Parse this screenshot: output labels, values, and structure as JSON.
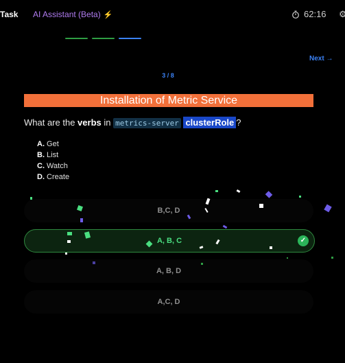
{
  "topbar": {
    "task_label": "Task",
    "ai_label": "AI Assistant (Beta)",
    "timer": "62:16"
  },
  "progress": {
    "segments": [
      {
        "color": "#2f9e44"
      },
      {
        "color": "#2f9e44"
      },
      {
        "color": "#3b82f6"
      }
    ]
  },
  "nav": {
    "next_label": "Next",
    "counter": "3 / 8"
  },
  "question": {
    "title": "Installation of Metric Service",
    "prefix": "What are the ",
    "bold": "verbs",
    "middle": " in ",
    "code": "metrics-server",
    "highlight": "clusterRole",
    "suffix": "?"
  },
  "options": [
    {
      "letter": "A.",
      "text": " Get"
    },
    {
      "letter": "B.",
      "text": " List"
    },
    {
      "letter": "C.",
      "text": " Watch"
    },
    {
      "letter": "D.",
      "text": " Create"
    }
  ],
  "answers": [
    {
      "label": "B,C, D",
      "selected": false
    },
    {
      "label": "A, B, C",
      "selected": true
    },
    {
      "label": "A, B, D",
      "selected": false
    },
    {
      "label": "A,C, D",
      "selected": false
    }
  ],
  "colors": {
    "accent_blue": "#3b82f6",
    "title_bg": "#f2703a",
    "success": "#4ade80",
    "purple": "#b07cf0"
  }
}
